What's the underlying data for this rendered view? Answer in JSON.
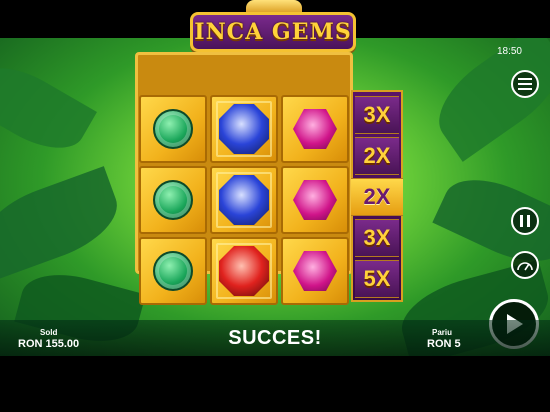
{
  "game": {
    "title": "INCA GEMS",
    "time": "18:50",
    "message": "SUCCES!"
  },
  "stats": {
    "balance_label": "Sold",
    "balance_value": "RON 155.00",
    "bet_label": "Pariu",
    "bet_value": "RON 5"
  },
  "reels": [
    [
      "emerald",
      "sapphire",
      "ruby-pink"
    ],
    [
      "emerald",
      "sapphire",
      "ruby-pink"
    ],
    [
      "emerald",
      "ruby-red",
      "ruby-pink"
    ]
  ],
  "multipliers": [
    {
      "label": "3X",
      "active": false
    },
    {
      "label": "2X",
      "active": false
    },
    {
      "label": "2X",
      "active": true
    },
    {
      "label": "3X",
      "active": false
    },
    {
      "label": "5X",
      "active": false
    }
  ],
  "colors": {
    "emerald": "#1aa65a",
    "sapphire": "#2a44d8",
    "ruby-pink": "#d0148a",
    "ruby-red": "#e0221e"
  },
  "icons": {
    "menu": "menu-icon",
    "pause": "pause-icon",
    "speed": "speedometer-icon",
    "spin": "play-icon"
  }
}
